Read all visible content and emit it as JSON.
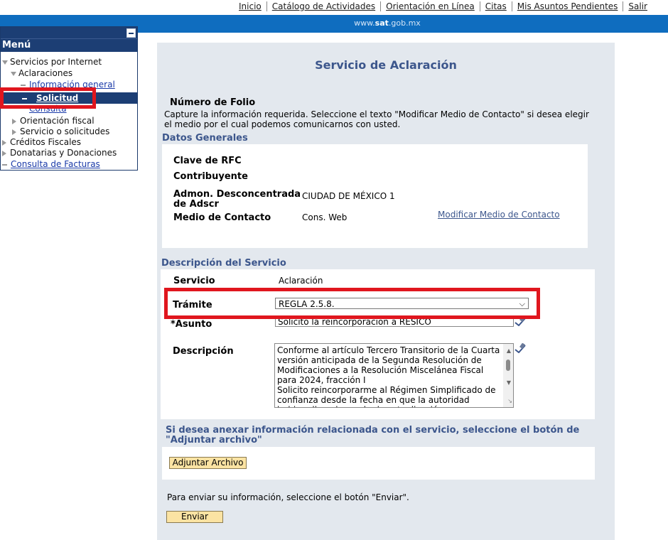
{
  "topnav": {
    "links": [
      "Inicio",
      "Catálogo de Actividades",
      "Orientación en Línea",
      "Citas",
      "Mis Asuntos Pendientes",
      "Salir"
    ]
  },
  "band": {
    "brand_pre": "www.",
    "brand_bold": "sat",
    "brand_post": ".gob.mx"
  },
  "menu": {
    "title": "Menú",
    "items": {
      "servicios": "Servicios por Internet",
      "aclaraciones": "Aclaraciones",
      "informacion": "Información general",
      "solicitud": "Solicitud",
      "consulta": "Consulta",
      "orientacion": "Orientación fiscal",
      "servicio_solicitudes": "Servicio o solicitudes",
      "creditos": "Créditos Fiscales",
      "donatarias": "Donatarias y Donaciones",
      "facturas": "Consulta de Facturas"
    }
  },
  "main": {
    "title": "Servicio de Aclaración",
    "folio_label": "Número de Folio",
    "instructions": "Capture la información requerida. Seleccione el texto \"Modificar Medio de Contacto\" si desea elegir el medio por el cual podemos comunicarnos con usted.",
    "datos": {
      "heading": "Datos Generales",
      "rfc_label": "Clave de RFC",
      "contrib_label": "Contribuyente",
      "admon_label": "Admon. Desconcentrada de Adscr",
      "admon_value": "CIUDAD DE MÉXICO 1",
      "medio_label": "Medio de Contacto",
      "medio_value": "Cons. Web",
      "modificar_link": "Modificar Medio de Contacto"
    },
    "descripcion": {
      "heading": "Descripción del Servicio",
      "servicio_label": "Servicio",
      "servicio_value": "Aclaración",
      "tramite_label": "Trámite",
      "tramite_value": "REGLA 2.5.8.",
      "asunto_label": "*Asunto",
      "asunto_value": "Solicito la reincorporación a RESICO",
      "desc_label": "Descripción",
      "desc_value": "Conforme al artículo Tercero Transitorio de la Cuarta versión anticipada de la Segunda Resolución de Modificaciones a la Resolución Miscelánea Fiscal para 2024, fracción I\nSolicito reincorporarme al Régimen Simplificado de confianza desde la fecha en que la autoridad hubiere llevado a cabo la actualización"
    },
    "adjuntar": {
      "text": "Si desea anexar información relacionada con el servicio, seleccione el botón de \"Adjuntar archivo\"",
      "button": "Adjuntar Archivo"
    },
    "enviar": {
      "text": "Para enviar su información, seleccione el botón \"Enviar\".",
      "button": "Enviar"
    }
  },
  "colors": {
    "accent_blue": "#0f6dbf",
    "navy": "#1c3e74",
    "highlight_red": "#e0161e",
    "button_yellow": "#fbe3a3"
  }
}
